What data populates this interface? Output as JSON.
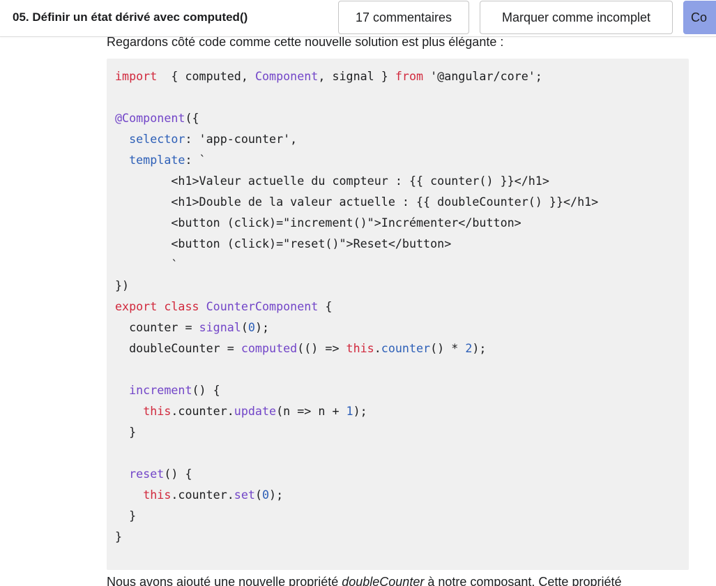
{
  "header": {
    "lesson_title": "05. Définir un état dérivé avec computed()",
    "comments_button": "17 commentaires",
    "mark_incomplete_button": "Marquer comme incomplet",
    "continue_button": "Co"
  },
  "article": {
    "intro_text": "Regardons côté code comme cette nouvelle solution est plus élégante :",
    "outro_text_start": "Nous avons ajouté une nouvelle propriété ",
    "outro_text_em": "doubleCounter",
    "outro_text_end": " à notre composant. Cette propriété"
  },
  "code_lines": [
    [
      [
        "kw",
        "import"
      ],
      [
        "",
        "  { computed, "
      ],
      [
        "fn",
        "Component"
      ],
      [
        "",
        ", signal } "
      ],
      [
        "kw",
        "from"
      ],
      [
        "",
        " '@angular/core';"
      ]
    ],
    [
      [
        "",
        ""
      ]
    ],
    [
      [
        "fn",
        "@Component"
      ],
      [
        "",
        "({"
      ]
    ],
    [
      [
        "",
        "  "
      ],
      [
        "prop",
        "selector"
      ],
      [
        "",
        ": 'app-counter',"
      ]
    ],
    [
      [
        "",
        "  "
      ],
      [
        "prop",
        "template"
      ],
      [
        "",
        ": `"
      ]
    ],
    [
      [
        "",
        "        <h1>Valeur actuelle du compteur : {{ counter() }}</h1>"
      ]
    ],
    [
      [
        "",
        "        <h1>Double de la valeur actuelle : {{ doubleCounter() }}</h1>"
      ]
    ],
    [
      [
        "",
        "        <button (click)=\"increment()\">Incrémenter</button>"
      ]
    ],
    [
      [
        "",
        "        <button (click)=\"reset()\">Reset</button>"
      ]
    ],
    [
      [
        "",
        "        `"
      ]
    ],
    [
      [
        "",
        "})"
      ]
    ],
    [
      [
        "kw",
        "export"
      ],
      [
        "",
        ""
      ],
      [
        "kw",
        " class"
      ],
      [
        "",
        ""
      ],
      [
        "fn",
        " CounterComponent"
      ],
      [
        "",
        " {"
      ]
    ],
    [
      [
        "",
        "  counter = "
      ],
      [
        "fn",
        "signal"
      ],
      [
        "",
        "("
      ],
      [
        "num",
        "0"
      ],
      [
        "",
        ");"
      ]
    ],
    [
      [
        "",
        "  doubleCounter = "
      ],
      [
        "fn",
        "computed"
      ],
      [
        "",
        "(() => "
      ],
      [
        "kw",
        "this"
      ],
      [
        "",
        "."
      ],
      [
        "prop",
        "counter"
      ],
      [
        "",
        "() * "
      ],
      [
        "num",
        "2"
      ],
      [
        "",
        ");"
      ]
    ],
    [
      [
        "",
        ""
      ]
    ],
    [
      [
        "",
        "  "
      ],
      [
        "fn",
        "increment"
      ],
      [
        "",
        "() {"
      ]
    ],
    [
      [
        "",
        "    "
      ],
      [
        "kw",
        "this"
      ],
      [
        "",
        ".counter."
      ],
      [
        "fn",
        "update"
      ],
      [
        "",
        "(n => n + "
      ],
      [
        "num",
        "1"
      ],
      [
        "",
        ");"
      ]
    ],
    [
      [
        "",
        "  }"
      ]
    ],
    [
      [
        "",
        ""
      ]
    ],
    [
      [
        "",
        "  "
      ],
      [
        "fn",
        "reset"
      ],
      [
        "",
        "() {"
      ]
    ],
    [
      [
        "",
        "    "
      ],
      [
        "kw",
        "this"
      ],
      [
        "",
        ".counter."
      ],
      [
        "fn",
        "set"
      ],
      [
        "",
        "("
      ],
      [
        "num",
        "0"
      ],
      [
        "",
        ");"
      ]
    ],
    [
      [
        "",
        "  }"
      ]
    ],
    [
      [
        "",
        "}"
      ]
    ]
  ]
}
